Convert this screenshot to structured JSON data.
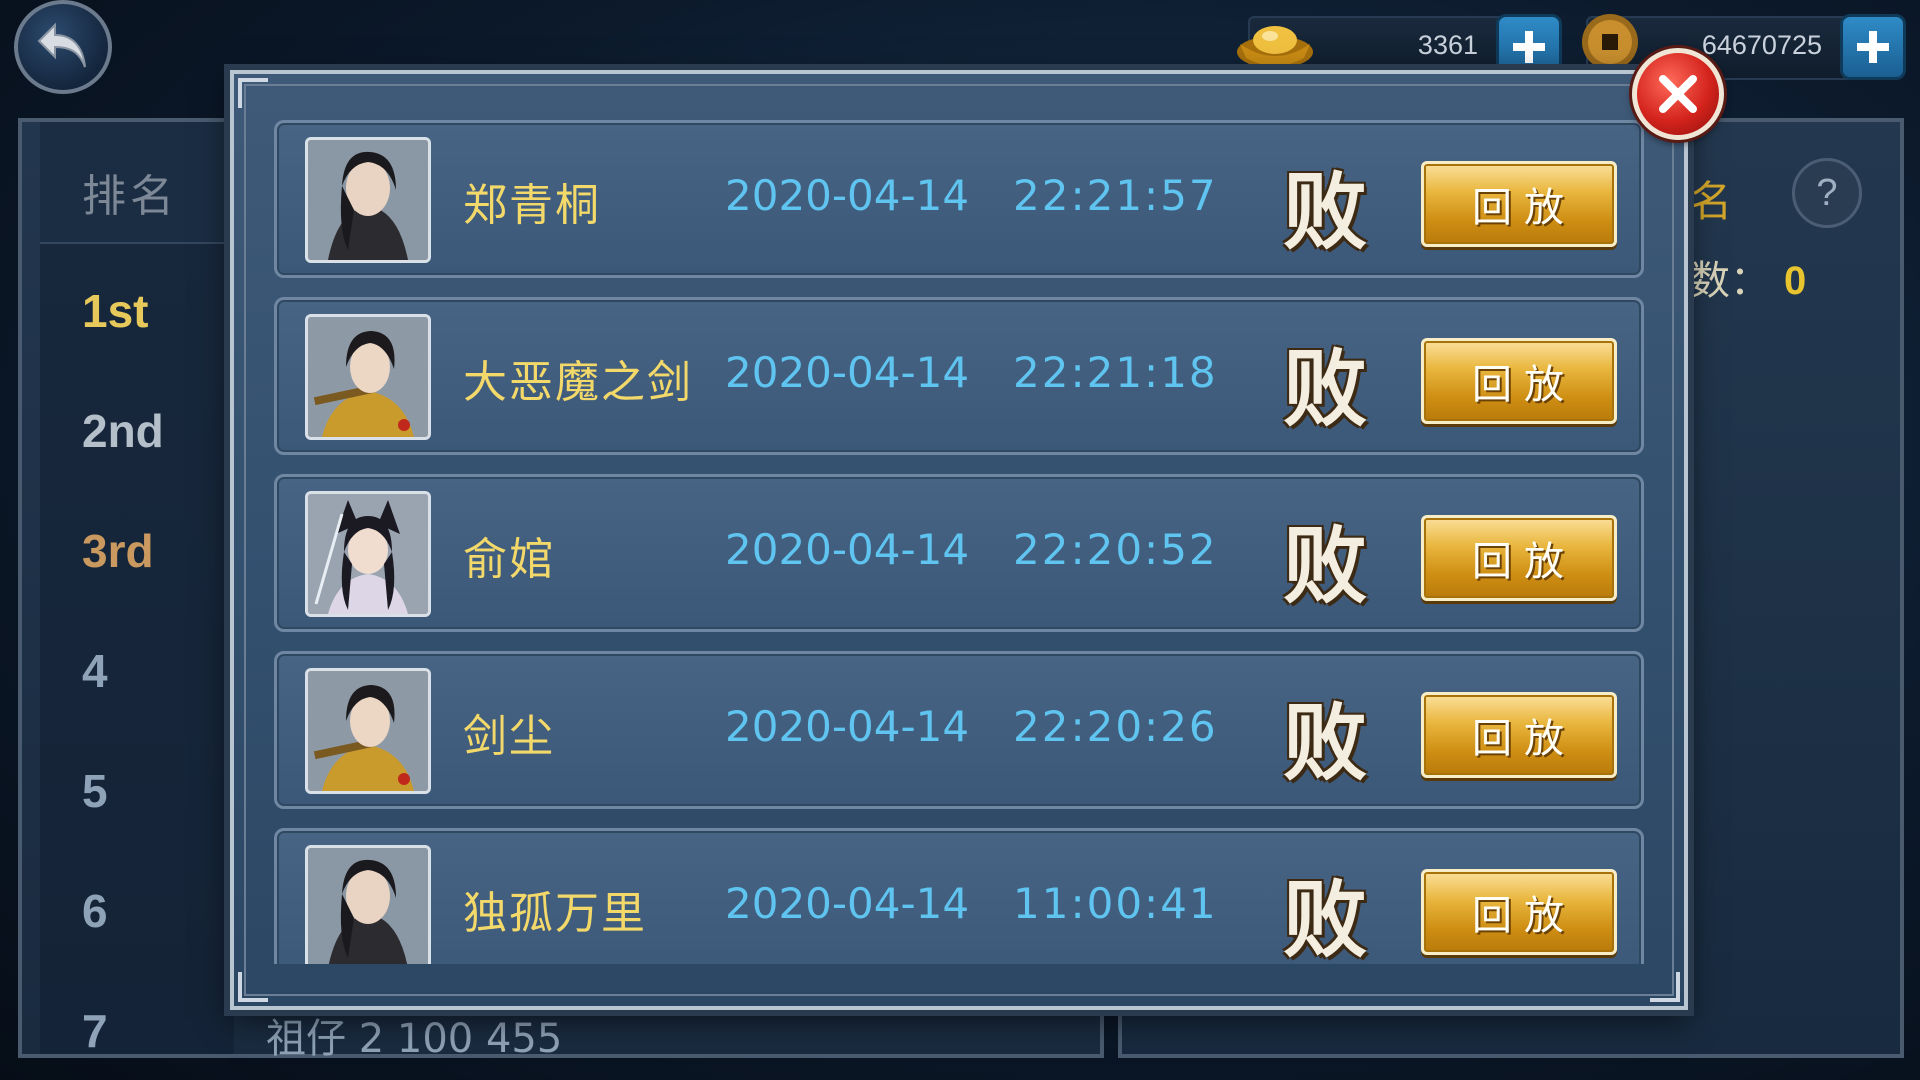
{
  "currency": {
    "gold_ingots": "3361",
    "coins": "64670725"
  },
  "background": {
    "rank_header": "排名",
    "ranks": [
      "1st",
      "2nd",
      "3rd",
      "4",
      "5",
      "6",
      "7"
    ],
    "partial_row": "祖仔          2          100          455",
    "right_partial_title": "名",
    "right_partial_label": "数：",
    "right_partial_value": "0",
    "help_label": "?"
  },
  "dialog": {
    "replay_label": "回放",
    "records": [
      {
        "name": "郑青桐",
        "date": "2020-04-14",
        "time": "22:21:57",
        "result": "败"
      },
      {
        "name": "大恶魔之剑",
        "date": "2020-04-14",
        "time": "22:21:18",
        "result": "败"
      },
      {
        "name": "俞婠",
        "date": "2020-04-14",
        "time": "22:20:52",
        "result": "败"
      },
      {
        "name": "剑尘",
        "date": "2020-04-14",
        "time": "22:20:26",
        "result": "败"
      },
      {
        "name": "独孤万里",
        "date": "2020-04-14",
        "time": "11:00:41",
        "result": "败"
      }
    ]
  },
  "icons": {
    "back": "back-arrow-icon",
    "gold": "gold-ingot-icon",
    "coin": "copper-coin-icon",
    "plus": "plus-icon",
    "close": "close-icon",
    "help": "help-icon"
  },
  "colors": {
    "name": "#f3d86a",
    "datetime": "#5fc4ef",
    "replay_button": "#e9b63e",
    "close_button": "#d3231c"
  }
}
